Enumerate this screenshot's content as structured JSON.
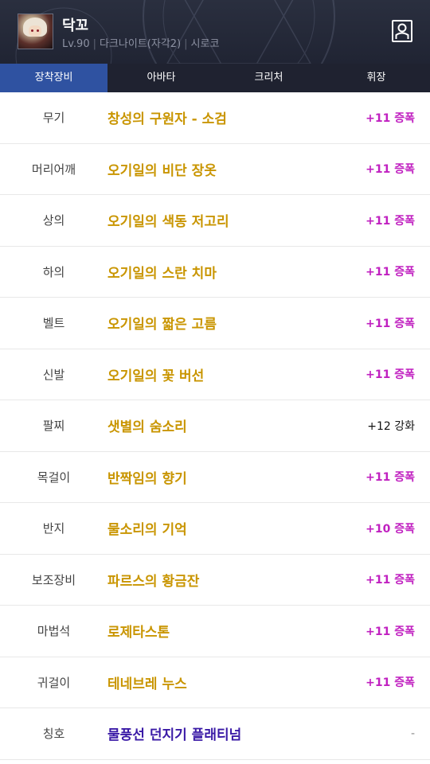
{
  "header": {
    "name": "닥꼬",
    "level": "Lv.90",
    "class": "다크나이트(자각2)",
    "server": "시로코",
    "avatar_icon": "character-portrait",
    "profile_icon": "person-icon"
  },
  "tabs": [
    {
      "label": "장착장비",
      "active": true
    },
    {
      "label": "아바타",
      "active": false
    },
    {
      "label": "크리처",
      "active": false
    },
    {
      "label": "휘장",
      "active": false
    }
  ],
  "equipment": [
    {
      "slot": "무기",
      "item": "창성의 구원자 - 소검",
      "enhance": "+11 증폭"
    },
    {
      "slot": "머리어깨",
      "item": "오기일의 비단 장옷",
      "enhance": "+11 증폭"
    },
    {
      "slot": "상의",
      "item": "오기일의 색동 저고리",
      "enhance": "+11 증폭"
    },
    {
      "slot": "하의",
      "item": "오기일의 스란 치마",
      "enhance": "+11 증폭"
    },
    {
      "slot": "벨트",
      "item": "오기일의 짧은 고름",
      "enhance": "+11 증폭"
    },
    {
      "slot": "신발",
      "item": "오기일의 꽃 버선",
      "enhance": "+11 증폭"
    },
    {
      "slot": "팔찌",
      "item": "샛별의 숨소리",
      "enhance": "+12 강화"
    },
    {
      "slot": "목걸이",
      "item": "반짝임의 향기",
      "enhance": "+11 증폭"
    },
    {
      "slot": "반지",
      "item": "물소리의 기억",
      "enhance": "+10 증폭"
    },
    {
      "slot": "보조장비",
      "item": "파르스의 황금잔",
      "enhance": "+11 증폭"
    },
    {
      "slot": "마법석",
      "item": "로제타스톤",
      "enhance": "+11 증폭"
    },
    {
      "slot": "귀걸이",
      "item": "테네브레 누스",
      "enhance": "+11 증폭"
    },
    {
      "slot": "칭호",
      "item": "물풍선 던지기 플래티넘",
      "enhance": "-"
    }
  ],
  "colors": {
    "epic_item": "#c99500",
    "title_item": "#3a1aa6",
    "amplify": "#c020c0",
    "active_tab": "#2f52a1"
  }
}
